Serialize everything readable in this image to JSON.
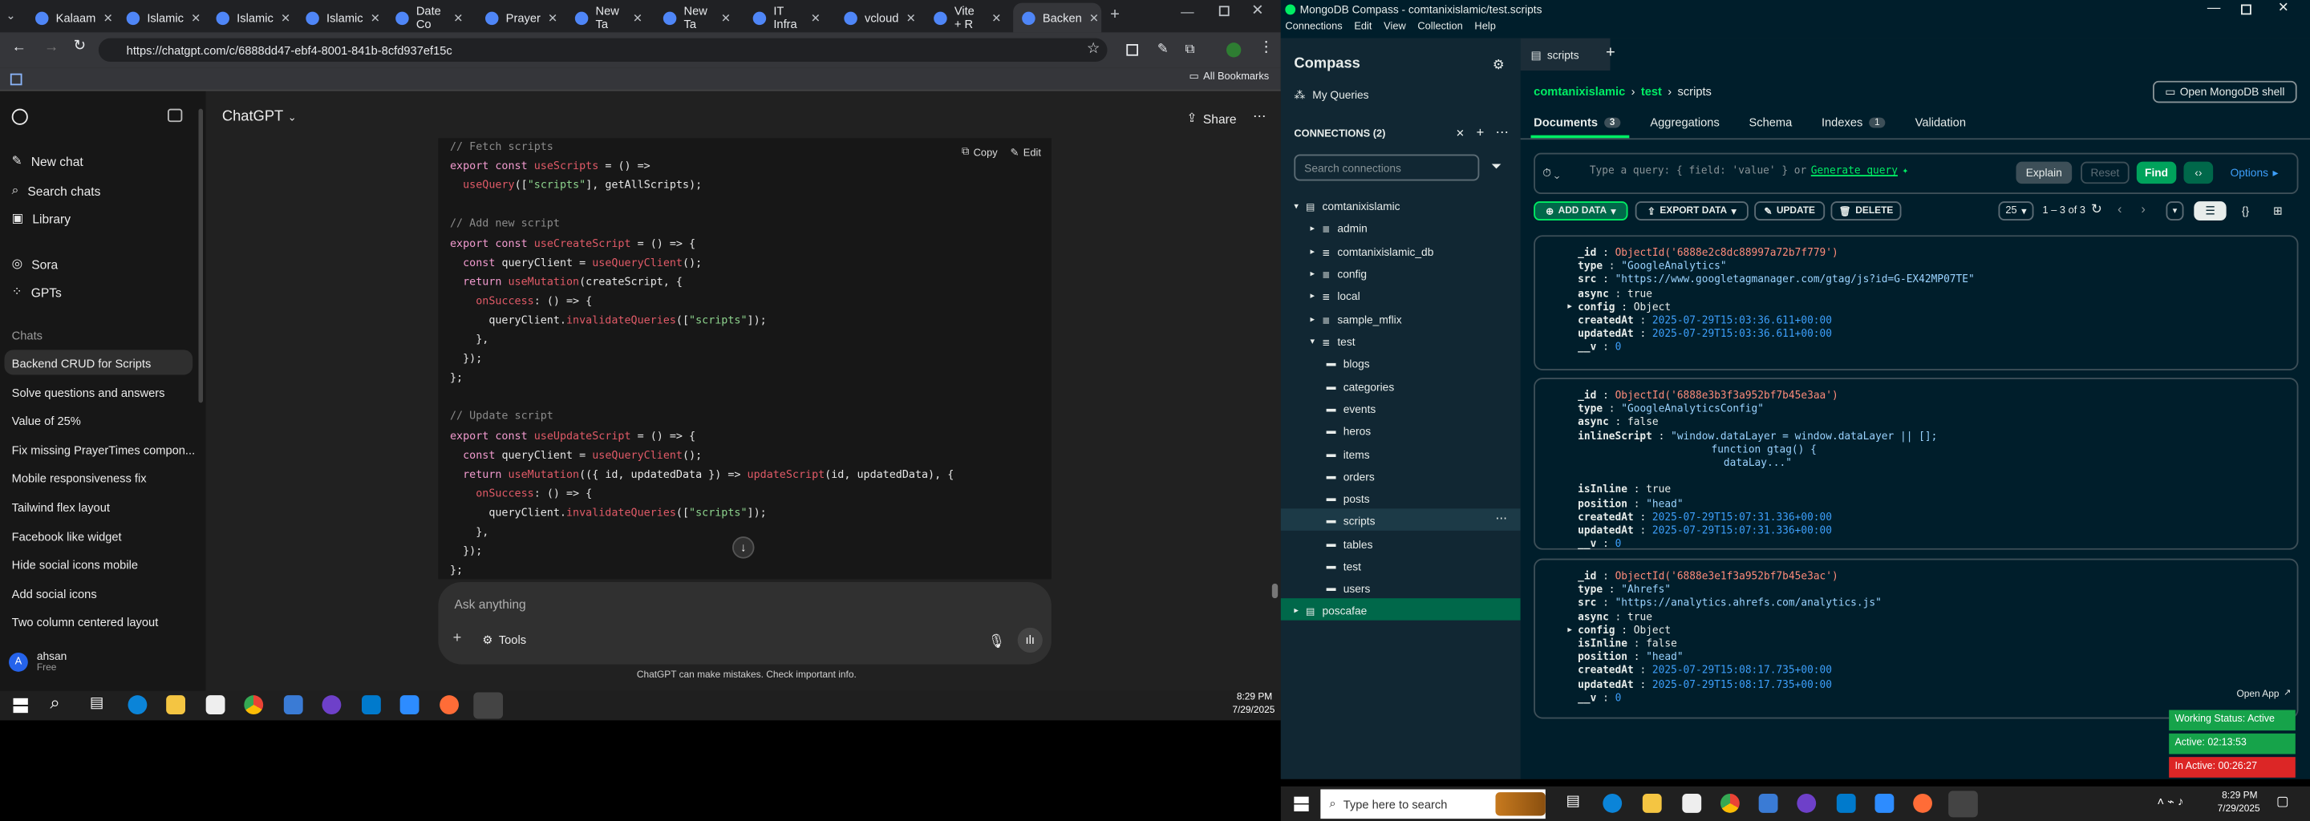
{
  "chrome": {
    "tabs": [
      "Kalaam",
      "Islamic",
      "Islamic",
      "Islamic",
      "Date Co",
      "Prayer",
      "New Ta",
      "New Ta",
      "IT Infra",
      "vcloud",
      "Vite + R",
      "Backen"
    ],
    "url": "https://chatgpt.com/c/6888dd47-ebf4-8001-841b-8cfd937ef15c",
    "bookmarks": "All Bookmarks"
  },
  "chatgpt": {
    "brand": "ChatGPT",
    "share": "Share",
    "new_chat": "New chat",
    "search": "Search chats",
    "library": "Library",
    "sora": "Sora",
    "gpts": "GPTs",
    "chats_heading": "Chats",
    "chats": [
      "Backend CRUD for Scripts",
      "Solve questions and answers",
      "Value of 25%",
      "Fix missing PrayerTimes compon...",
      "Mobile responsiveness fix",
      "Tailwind flex layout",
      "Facebook like widget",
      "Hide social icons mobile",
      "Add social icons",
      "Two column centered layout"
    ],
    "user": {
      "initial": "A",
      "name": "ahsan",
      "plan": "Free"
    },
    "copy": "Copy",
    "edit": "Edit",
    "prompt_placeholder": "Ask anything",
    "tools": "Tools",
    "disclaimer": "ChatGPT can make mistakes. Check important info."
  },
  "code": [
    [
      [
        "cm",
        "// Fetch scripts"
      ]
    ],
    [
      [
        "kw",
        "export const "
      ],
      [
        "fn",
        "useScripts"
      ],
      [
        "id",
        " = () =>"
      ]
    ],
    [
      [
        "id",
        "  "
      ],
      [
        "fn",
        "useQuery"
      ],
      [
        "id",
        "(["
      ],
      [
        "st",
        "\"scripts\""
      ],
      [
        "id",
        "], getAllScripts);"
      ]
    ],
    [
      [
        "id",
        ""
      ]
    ],
    [
      [
        "cm",
        "// Add new script"
      ]
    ],
    [
      [
        "kw",
        "export const "
      ],
      [
        "fn",
        "useCreateScript"
      ],
      [
        "id",
        " = () => {"
      ]
    ],
    [
      [
        "kw",
        "  const "
      ],
      [
        "id",
        "queryClient = "
      ],
      [
        "fn",
        "useQueryClient"
      ],
      [
        "id",
        "();"
      ]
    ],
    [
      [
        "kw",
        "  return "
      ],
      [
        "fn",
        "useMutation"
      ],
      [
        "id",
        "(createScript, {"
      ]
    ],
    [
      [
        "fn",
        "    onSuccess"
      ],
      [
        "id",
        ": () => {"
      ]
    ],
    [
      [
        "id",
        "      queryClient."
      ],
      [
        "fn",
        "invalidateQueries"
      ],
      [
        "id",
        "(["
      ],
      [
        "st",
        "\"scripts\""
      ],
      [
        "id",
        "]);"
      ]
    ],
    [
      [
        "id",
        "    },"
      ]
    ],
    [
      [
        "id",
        "  });"
      ]
    ],
    [
      [
        "id",
        "};"
      ]
    ],
    [
      [
        "id",
        ""
      ]
    ],
    [
      [
        "cm",
        "// Update script"
      ]
    ],
    [
      [
        "kw",
        "export const "
      ],
      [
        "fn",
        "useUpdateScript"
      ],
      [
        "id",
        " = () => {"
      ]
    ],
    [
      [
        "kw",
        "  const "
      ],
      [
        "id",
        "queryClient = "
      ],
      [
        "fn",
        "useQueryClient"
      ],
      [
        "id",
        "();"
      ]
    ],
    [
      [
        "kw",
        "  return "
      ],
      [
        "fn",
        "useMutation"
      ],
      [
        "id",
        "(({ id, updatedData }) => "
      ],
      [
        "fn",
        "updateScript"
      ],
      [
        "id",
        "(id, updatedData), {"
      ]
    ],
    [
      [
        "fn",
        "    onSuccess"
      ],
      [
        "id",
        ": () => {"
      ]
    ],
    [
      [
        "id",
        "      queryClient."
      ],
      [
        "fn",
        "invalidateQueries"
      ],
      [
        "id",
        "(["
      ],
      [
        "st",
        "\"scripts\""
      ],
      [
        "id",
        "]);"
      ]
    ],
    [
      [
        "id",
        "    },"
      ]
    ],
    [
      [
        "id",
        "  });"
      ]
    ],
    [
      [
        "id",
        "};"
      ]
    ]
  ],
  "taskbar_left": {
    "time": "8:29 PM",
    "date": "7/29/2025"
  },
  "compass": {
    "window_title": "MongoDB Compass - comtanixislamic/test.scripts",
    "menu": [
      "Connections",
      "Edit",
      "View",
      "Collection",
      "Help"
    ],
    "app": "Compass",
    "my_queries": "My Queries",
    "connections_label": "CONNECTIONS (2)",
    "search_placeholder": "Search connections",
    "tree": [
      {
        "label": "comtanixislamic",
        "level": 0,
        "type": "conn",
        "open": true
      },
      {
        "label": "admin",
        "level": 1,
        "type": "db"
      },
      {
        "label": "comtanixislamic_db",
        "level": 1,
        "type": "db"
      },
      {
        "label": "config",
        "level": 1,
        "type": "db"
      },
      {
        "label": "local",
        "level": 1,
        "type": "db"
      },
      {
        "label": "sample_mflix",
        "level": 1,
        "type": "db"
      },
      {
        "label": "test",
        "level": 1,
        "type": "db",
        "open": true
      },
      {
        "label": "blogs",
        "level": 2,
        "type": "coll"
      },
      {
        "label": "categories",
        "level": 2,
        "type": "coll"
      },
      {
        "label": "events",
        "level": 2,
        "type": "coll"
      },
      {
        "label": "heros",
        "level": 2,
        "type": "coll"
      },
      {
        "label": "items",
        "level": 2,
        "type": "coll"
      },
      {
        "label": "orders",
        "level": 2,
        "type": "coll"
      },
      {
        "label": "posts",
        "level": 2,
        "type": "coll"
      },
      {
        "label": "scripts",
        "level": 2,
        "type": "coll",
        "selected": true
      },
      {
        "label": "tables",
        "level": 2,
        "type": "coll"
      },
      {
        "label": "test",
        "level": 2,
        "type": "coll"
      },
      {
        "label": "users",
        "level": 2,
        "type": "coll"
      },
      {
        "label": "poscafae",
        "level": 0,
        "type": "conn",
        "active": true
      }
    ],
    "tab_label": "scripts",
    "breadcrumb": {
      "conn": "comtanixislamic",
      "db": "test",
      "coll": "scripts"
    },
    "open_shell": "Open MongoDB shell",
    "subtabs": [
      {
        "label": "Documents",
        "count": "3"
      },
      {
        "label": "Aggregations"
      },
      {
        "label": "Schema"
      },
      {
        "label": "Indexes",
        "count": "1"
      },
      {
        "label": "Validation"
      }
    ],
    "query_placeholder": "Type a query: { field: 'value' } or",
    "generate_query": "Generate query",
    "explain": "Explain",
    "reset": "Reset",
    "find": "Find",
    "options": "Options",
    "add_data": "ADD DATA",
    "export_data": "EXPORT DATA",
    "update": "UPDATE",
    "delete": "DELETE",
    "page_size": "25",
    "range": "1 – 3 of 3",
    "docs": [
      [
        [
          "_id",
          "ObjectId('6888e2c8dc88997a72b7f779')",
          "oid"
        ],
        [
          "type",
          "\"GoogleAnalytics\"",
          "str"
        ],
        [
          "src",
          "\"https://www.googletagmanager.com/gtag/js?id=G-EX42MP07TE\"",
          "str"
        ],
        [
          "async",
          "true",
          "bool"
        ],
        [
          "config",
          "Object",
          "obj"
        ],
        [
          "createdAt",
          "2025-07-29T15:03:36.611+00:00",
          "date"
        ],
        [
          "updatedAt",
          "2025-07-29T15:03:36.611+00:00",
          "date"
        ],
        [
          "__v",
          "0",
          "num"
        ]
      ],
      [
        [
          "_id",
          "ObjectId('6888e3b3f3a952bf7b45e3aa')",
          "oid"
        ],
        [
          "type",
          "\"GoogleAnalyticsConfig\"",
          "str"
        ],
        [
          "async",
          "false",
          "bool"
        ],
        [
          "inlineScript",
          "\"window.dataLayer = window.dataLayer || [];",
          "str"
        ],
        [
          "",
          "        function gtag() {",
          "cont"
        ],
        [
          "",
          "          dataLay...\"",
          "cont"
        ],
        [
          "",
          "",
          " "
        ],
        [
          "isInline",
          "true",
          "bool"
        ],
        [
          "position",
          "\"head\"",
          "str"
        ],
        [
          "createdAt",
          "2025-07-29T15:07:31.336+00:00",
          "date"
        ],
        [
          "updatedAt",
          "2025-07-29T15:07:31.336+00:00",
          "date"
        ],
        [
          "__v",
          "0",
          "num"
        ]
      ],
      [
        [
          "_id",
          "ObjectId('6888e3e1f3a952bf7b45e3ac')",
          "oid"
        ],
        [
          "type",
          "\"Ahrefs\"",
          "str"
        ],
        [
          "src",
          "\"https://analytics.ahrefs.com/analytics.js\"",
          "str"
        ],
        [
          "async",
          "true",
          "bool"
        ],
        [
          "config",
          "Object",
          "obj"
        ],
        [
          "isInline",
          "false",
          "bool"
        ],
        [
          "position",
          "\"head\"",
          "str"
        ],
        [
          "createdAt",
          "2025-07-29T15:08:17.735+00:00",
          "date"
        ],
        [
          "updatedAt",
          "2025-07-29T15:08:17.735+00:00",
          "date"
        ],
        [
          "__v",
          "0",
          "num"
        ]
      ]
    ]
  },
  "tracker": {
    "open_app": "Open App",
    "working": "Working Status: Active",
    "active": "Active: 02:13:53",
    "inactive": "In Active: 00:26:27"
  },
  "taskbar_right": {
    "search": "Type here to search",
    "time": "8:29 PM",
    "date": "7/29/2025"
  },
  "colors": {
    "compass_green": "#00ed64",
    "active_green": "#16a34a",
    "inactive_red": "#dc2626"
  }
}
